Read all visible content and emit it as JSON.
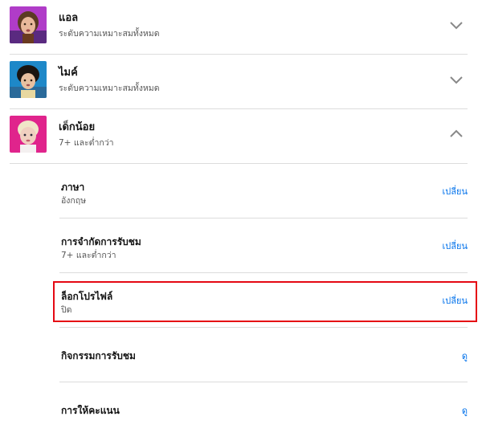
{
  "profiles": [
    {
      "name": "แอล",
      "rating": "ระดับความเหมาะสมทั้งหมด",
      "avatar_icon": "avatar-girl-icon",
      "expanded": false
    },
    {
      "name": "ไมค์",
      "rating": "ระดับความเหมาะสมทั้งหมด",
      "avatar_icon": "avatar-boy-icon",
      "expanded": false
    },
    {
      "name": "เด็กน้อย",
      "rating": "7+ และต่ำกว่า",
      "avatar_icon": "avatar-kid-icon",
      "expanded": true
    }
  ],
  "settings": [
    {
      "title": "ภาษา",
      "value": "อังกฤษ",
      "action": "เปลี่ยน"
    },
    {
      "title": "การจำกัดการรับชม",
      "value": "7+ และต่ำกว่า",
      "action": "เปลี่ยน"
    },
    {
      "title": "ล็อกโปรไฟล์",
      "value": "ปิด",
      "action": "เปลี่ยน",
      "highlighted": true
    },
    {
      "title": "กิจกรรมการรับชม",
      "value": "",
      "action": "ดู"
    },
    {
      "title": "การให้คะแนน",
      "value": "",
      "action": "ดู"
    }
  ],
  "colors": {
    "link": "#0071eb",
    "highlight": "#e50914",
    "divider": "#dcdcdc"
  }
}
